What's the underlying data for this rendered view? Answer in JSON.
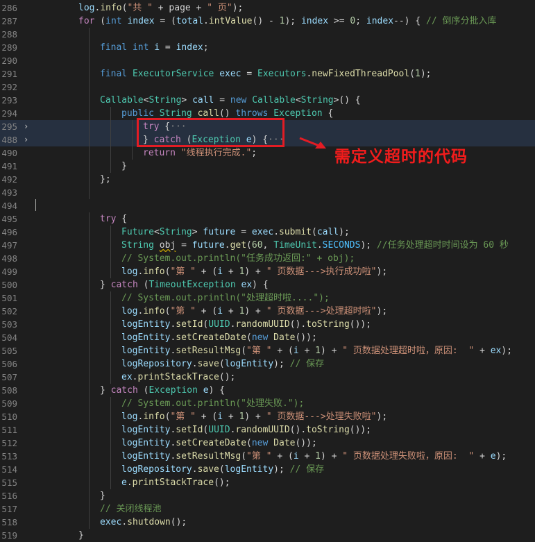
{
  "annotation": {
    "text": "需定义超时的代码"
  },
  "lines": [
    {
      "n": "286",
      "indent": 0,
      "tokens": [
        [
          "v",
          "log"
        ],
        [
          "p",
          "."
        ],
        [
          "f",
          "info"
        ],
        [
          "p",
          "("
        ],
        [
          "s",
          "\"共 \""
        ],
        [
          "p",
          " + page + "
        ],
        [
          "s",
          "\" 页\""
        ],
        [
          "p",
          ");"
        ]
      ]
    },
    {
      "n": "287",
      "indent": 0,
      "tokens": [
        [
          "ctl",
          "for"
        ],
        [
          "p",
          " ("
        ],
        [
          "k",
          "int"
        ],
        [
          "p",
          " "
        ],
        [
          "v",
          "index"
        ],
        [
          "p",
          " = ("
        ],
        [
          "v",
          "total"
        ],
        [
          "p",
          "."
        ],
        [
          "f",
          "intValue"
        ],
        [
          "p",
          "() - "
        ],
        [
          "n",
          "1"
        ],
        [
          "p",
          "); "
        ],
        [
          "v",
          "index"
        ],
        [
          "p",
          " >= "
        ],
        [
          "n",
          "0"
        ],
        [
          "p",
          "; "
        ],
        [
          "v",
          "index"
        ],
        [
          "p",
          "--) { "
        ],
        [
          "cm",
          "// 倒序分批入库"
        ]
      ]
    },
    {
      "n": "288",
      "indent": 1,
      "tokens": []
    },
    {
      "n": "289",
      "indent": 1,
      "tokens": [
        [
          "k",
          "final"
        ],
        [
          "p",
          " "
        ],
        [
          "k",
          "int"
        ],
        [
          "p",
          " "
        ],
        [
          "v",
          "i"
        ],
        [
          "p",
          " = "
        ],
        [
          "v",
          "index"
        ],
        [
          "p",
          ";"
        ]
      ]
    },
    {
      "n": "290",
      "indent": 1,
      "tokens": []
    },
    {
      "n": "291",
      "indent": 1,
      "tokens": [
        [
          "k",
          "final"
        ],
        [
          "p",
          " "
        ],
        [
          "c",
          "ExecutorService"
        ],
        [
          "p",
          " "
        ],
        [
          "v",
          "exec"
        ],
        [
          "p",
          " = "
        ],
        [
          "c",
          "Executors"
        ],
        [
          "p",
          "."
        ],
        [
          "f",
          "newFixedThreadPool"
        ],
        [
          "p",
          "("
        ],
        [
          "n",
          "1"
        ],
        [
          "p",
          ");"
        ]
      ]
    },
    {
      "n": "292",
      "indent": 1,
      "tokens": []
    },
    {
      "n": "293",
      "indent": 1,
      "tokens": [
        [
          "c",
          "Callable"
        ],
        [
          "p",
          "<"
        ],
        [
          "c",
          "String"
        ],
        [
          "p",
          "> "
        ],
        [
          "v",
          "call"
        ],
        [
          "p",
          " = "
        ],
        [
          "k",
          "new"
        ],
        [
          "p",
          " "
        ],
        [
          "c",
          "Callable"
        ],
        [
          "p",
          "<"
        ],
        [
          "c",
          "String"
        ],
        [
          "p",
          ">() {"
        ]
      ]
    },
    {
      "n": "294",
      "indent": 2,
      "tokens": [
        [
          "k",
          "public"
        ],
        [
          "p",
          " "
        ],
        [
          "c",
          "String"
        ],
        [
          "p",
          " "
        ],
        [
          "f",
          "call"
        ],
        [
          "p",
          "() "
        ],
        [
          "k",
          "throws"
        ],
        [
          "p",
          " "
        ],
        [
          "c",
          "Exception"
        ],
        [
          "p",
          " {"
        ]
      ]
    },
    {
      "n": "295",
      "indent": 3,
      "fold": "›",
      "hl": true,
      "tokens": [
        [
          "ctl",
          "try"
        ],
        [
          "p",
          " {"
        ],
        [
          "el",
          "···"
        ]
      ]
    },
    {
      "n": "488",
      "indent": 3,
      "fold": "›",
      "hl": true,
      "tokens": [
        [
          "p",
          "} "
        ],
        [
          "ctl",
          "catch"
        ],
        [
          "p",
          " ("
        ],
        [
          "c",
          "Exception"
        ],
        [
          "p",
          " "
        ],
        [
          "v",
          "e"
        ],
        [
          "p",
          ") {"
        ],
        [
          "el",
          "···"
        ]
      ]
    },
    {
      "n": "490",
      "indent": 3,
      "tokens": [
        [
          "ctl",
          "return"
        ],
        [
          "p",
          " "
        ],
        [
          "s",
          "\"线程执行完成.\""
        ],
        [
          "p",
          ";"
        ]
      ]
    },
    {
      "n": "491",
      "indent": 2,
      "tokens": [
        [
          "p",
          "}"
        ]
      ]
    },
    {
      "n": "492",
      "indent": 1,
      "tokens": [
        [
          "p",
          "};"
        ]
      ]
    },
    {
      "n": "493",
      "indent": 1,
      "tokens": []
    },
    {
      "n": "494",
      "indent": 0,
      "cursor": true,
      "tokens": []
    },
    {
      "n": "495",
      "indent": 1,
      "tokens": [
        [
          "ctl",
          "try"
        ],
        [
          "p",
          " {"
        ]
      ]
    },
    {
      "n": "496",
      "indent": 2,
      "tokens": [
        [
          "c",
          "Future"
        ],
        [
          "p",
          "<"
        ],
        [
          "c",
          "String"
        ],
        [
          "p",
          "> "
        ],
        [
          "v",
          "future"
        ],
        [
          "p",
          " = "
        ],
        [
          "v",
          "exec"
        ],
        [
          "p",
          "."
        ],
        [
          "f",
          "submit"
        ],
        [
          "p",
          "("
        ],
        [
          "v",
          "call"
        ],
        [
          "p",
          ");"
        ]
      ]
    },
    {
      "n": "497",
      "indent": 2,
      "tokens": [
        [
          "c",
          "String"
        ],
        [
          "p",
          " "
        ],
        [
          "sq",
          "obj"
        ],
        [
          "p",
          " = "
        ],
        [
          "v",
          "future"
        ],
        [
          "p",
          "."
        ],
        [
          "f",
          "get"
        ],
        [
          "p",
          "("
        ],
        [
          "n",
          "60"
        ],
        [
          "p",
          ", "
        ],
        [
          "c",
          "TimeUnit"
        ],
        [
          "p",
          "."
        ],
        [
          "const",
          "SECONDS"
        ],
        [
          "p",
          "); "
        ],
        [
          "cm",
          "//任务处理超时时间设为 60 秒"
        ]
      ]
    },
    {
      "n": "498",
      "indent": 2,
      "tokens": [
        [
          "cm",
          "// System.out.println(\"任务成功返回:\" + obj);"
        ]
      ]
    },
    {
      "n": "499",
      "indent": 2,
      "tokens": [
        [
          "v",
          "log"
        ],
        [
          "p",
          "."
        ],
        [
          "f",
          "info"
        ],
        [
          "p",
          "("
        ],
        [
          "s",
          "\"第 \""
        ],
        [
          "p",
          " + ("
        ],
        [
          "v",
          "i"
        ],
        [
          "p",
          " + "
        ],
        [
          "n",
          "1"
        ],
        [
          "p",
          ") + "
        ],
        [
          "s",
          "\" 页数据--->执行成功啦\""
        ],
        [
          "p",
          ");"
        ]
      ]
    },
    {
      "n": "500",
      "indent": 1,
      "tokens": [
        [
          "p",
          "} "
        ],
        [
          "ctl",
          "catch"
        ],
        [
          "p",
          " ("
        ],
        [
          "c",
          "TimeoutException"
        ],
        [
          "p",
          " "
        ],
        [
          "v",
          "ex"
        ],
        [
          "p",
          ") {"
        ]
      ]
    },
    {
      "n": "501",
      "indent": 2,
      "tokens": [
        [
          "cm",
          "// System.out.println(\"处理超时啦....\");"
        ]
      ]
    },
    {
      "n": "502",
      "indent": 2,
      "tokens": [
        [
          "v",
          "log"
        ],
        [
          "p",
          "."
        ],
        [
          "f",
          "info"
        ],
        [
          "p",
          "("
        ],
        [
          "s",
          "\"第 \""
        ],
        [
          "p",
          " + ("
        ],
        [
          "v",
          "i"
        ],
        [
          "p",
          " + "
        ],
        [
          "n",
          "1"
        ],
        [
          "p",
          ") + "
        ],
        [
          "s",
          "\" 页数据--->处理超时啦\""
        ],
        [
          "p",
          ");"
        ]
      ]
    },
    {
      "n": "503",
      "indent": 2,
      "tokens": [
        [
          "v",
          "logEntity"
        ],
        [
          "p",
          "."
        ],
        [
          "f",
          "setId"
        ],
        [
          "p",
          "("
        ],
        [
          "c",
          "UUID"
        ],
        [
          "p",
          "."
        ],
        [
          "f",
          "randomUUID"
        ],
        [
          "p",
          "()."
        ],
        [
          "f",
          "toString"
        ],
        [
          "p",
          "());"
        ]
      ]
    },
    {
      "n": "504",
      "indent": 2,
      "tokens": [
        [
          "v",
          "logEntity"
        ],
        [
          "p",
          "."
        ],
        [
          "f",
          "setCreateDate"
        ],
        [
          "p",
          "("
        ],
        [
          "k",
          "new"
        ],
        [
          "p",
          " "
        ],
        [
          "f",
          "Date"
        ],
        [
          "p",
          "());"
        ]
      ]
    },
    {
      "n": "505",
      "indent": 2,
      "tokens": [
        [
          "v",
          "logEntity"
        ],
        [
          "p",
          "."
        ],
        [
          "f",
          "setResultMsg"
        ],
        [
          "p",
          "("
        ],
        [
          "s",
          "\"第 \""
        ],
        [
          "p",
          " + ("
        ],
        [
          "v",
          "i"
        ],
        [
          "p",
          " + "
        ],
        [
          "n",
          "1"
        ],
        [
          "p",
          ") + "
        ],
        [
          "s",
          "\" 页数据处理超时啦，原因:  \""
        ],
        [
          "p",
          " + "
        ],
        [
          "v",
          "ex"
        ],
        [
          "p",
          ");"
        ]
      ]
    },
    {
      "n": "506",
      "indent": 2,
      "tokens": [
        [
          "v",
          "logRepository"
        ],
        [
          "p",
          "."
        ],
        [
          "f",
          "save"
        ],
        [
          "p",
          "("
        ],
        [
          "v",
          "logEntity"
        ],
        [
          "p",
          "); "
        ],
        [
          "cm",
          "// 保存"
        ]
      ]
    },
    {
      "n": "507",
      "indent": 2,
      "tokens": [
        [
          "v",
          "ex"
        ],
        [
          "p",
          "."
        ],
        [
          "f",
          "printStackTrace"
        ],
        [
          "p",
          "();"
        ]
      ]
    },
    {
      "n": "508",
      "indent": 1,
      "tokens": [
        [
          "p",
          "} "
        ],
        [
          "ctl",
          "catch"
        ],
        [
          "p",
          " ("
        ],
        [
          "c",
          "Exception"
        ],
        [
          "p",
          " "
        ],
        [
          "v",
          "e"
        ],
        [
          "p",
          ") {"
        ]
      ]
    },
    {
      "n": "509",
      "indent": 2,
      "tokens": [
        [
          "cm",
          "// System.out.println(\"处理失败.\");"
        ]
      ]
    },
    {
      "n": "510",
      "indent": 2,
      "tokens": [
        [
          "v",
          "log"
        ],
        [
          "p",
          "."
        ],
        [
          "f",
          "info"
        ],
        [
          "p",
          "("
        ],
        [
          "s",
          "\"第 \""
        ],
        [
          "p",
          " + ("
        ],
        [
          "v",
          "i"
        ],
        [
          "p",
          " + "
        ],
        [
          "n",
          "1"
        ],
        [
          "p",
          ") + "
        ],
        [
          "s",
          "\" 页数据--->处理失败啦\""
        ],
        [
          "p",
          ");"
        ]
      ]
    },
    {
      "n": "511",
      "indent": 2,
      "tokens": [
        [
          "v",
          "logEntity"
        ],
        [
          "p",
          "."
        ],
        [
          "f",
          "setId"
        ],
        [
          "p",
          "("
        ],
        [
          "c",
          "UUID"
        ],
        [
          "p",
          "."
        ],
        [
          "f",
          "randomUUID"
        ],
        [
          "p",
          "()."
        ],
        [
          "f",
          "toString"
        ],
        [
          "p",
          "());"
        ]
      ]
    },
    {
      "n": "512",
      "indent": 2,
      "tokens": [
        [
          "v",
          "logEntity"
        ],
        [
          "p",
          "."
        ],
        [
          "f",
          "setCreateDate"
        ],
        [
          "p",
          "("
        ],
        [
          "k",
          "new"
        ],
        [
          "p",
          " "
        ],
        [
          "f",
          "Date"
        ],
        [
          "p",
          "());"
        ]
      ]
    },
    {
      "n": "513",
      "indent": 2,
      "tokens": [
        [
          "v",
          "logEntity"
        ],
        [
          "p",
          "."
        ],
        [
          "f",
          "setResultMsg"
        ],
        [
          "p",
          "("
        ],
        [
          "s",
          "\"第 \""
        ],
        [
          "p",
          " + ("
        ],
        [
          "v",
          "i"
        ],
        [
          "p",
          " + "
        ],
        [
          "n",
          "1"
        ],
        [
          "p",
          ") + "
        ],
        [
          "s",
          "\" 页数据处理失败啦，原因:  \""
        ],
        [
          "p",
          " + "
        ],
        [
          "v",
          "e"
        ],
        [
          "p",
          ");"
        ]
      ]
    },
    {
      "n": "514",
      "indent": 2,
      "tokens": [
        [
          "v",
          "logRepository"
        ],
        [
          "p",
          "."
        ],
        [
          "f",
          "save"
        ],
        [
          "p",
          "("
        ],
        [
          "v",
          "logEntity"
        ],
        [
          "p",
          "); "
        ],
        [
          "cm",
          "// 保存"
        ]
      ]
    },
    {
      "n": "515",
      "indent": 2,
      "tokens": [
        [
          "v",
          "e"
        ],
        [
          "p",
          "."
        ],
        [
          "f",
          "printStackTrace"
        ],
        [
          "p",
          "();"
        ]
      ]
    },
    {
      "n": "516",
      "indent": 1,
      "tokens": [
        [
          "p",
          "}"
        ]
      ]
    },
    {
      "n": "517",
      "indent": 1,
      "tokens": [
        [
          "cm",
          "// 关闭线程池"
        ]
      ]
    },
    {
      "n": "518",
      "indent": 1,
      "tokens": [
        [
          "v",
          "exec"
        ],
        [
          "p",
          "."
        ],
        [
          "f",
          "shutdown"
        ],
        [
          "p",
          "();"
        ]
      ]
    },
    {
      "n": "519",
      "indent": 0,
      "tokens": [
        [
          "p",
          "}"
        ]
      ]
    }
  ]
}
